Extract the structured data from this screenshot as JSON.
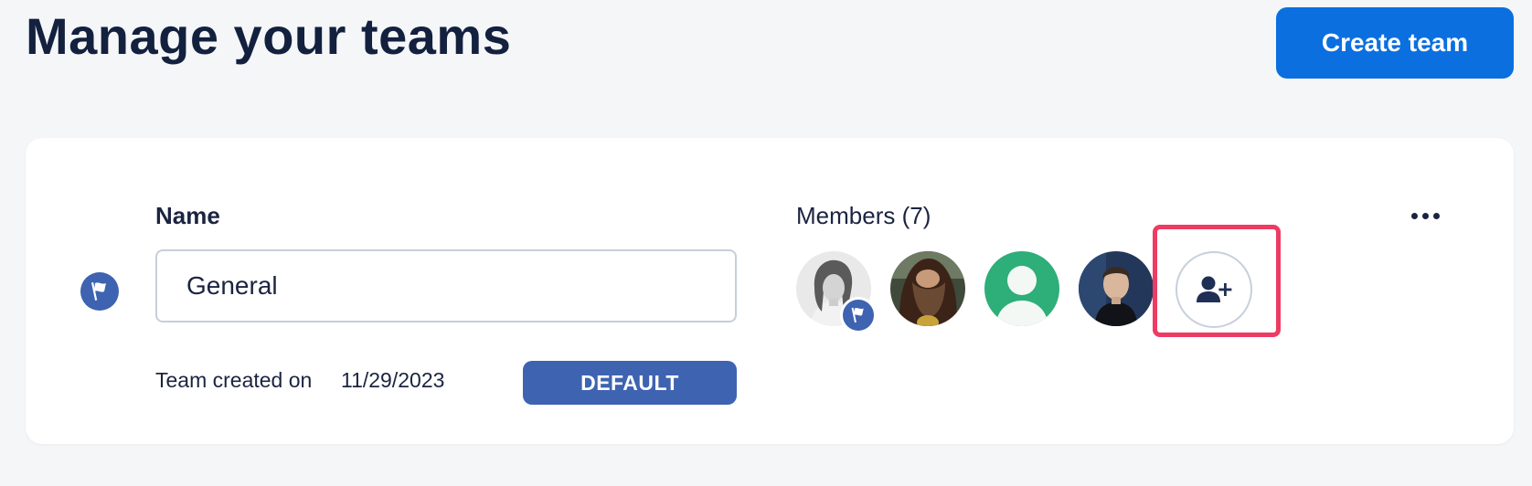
{
  "header": {
    "title": "Manage your teams",
    "create_button_label": "Create team"
  },
  "team": {
    "name_label": "Name",
    "name_value": "General",
    "created_label": "Team created on ",
    "created_date": "11/29/2023",
    "default_badge": "DEFAULT",
    "members_label": "Members (7)",
    "icons": {
      "team_icon": "flag-icon",
      "owner_badge": "flag-icon",
      "add_member": "add-user-icon",
      "menu": "more-horizontal-icon"
    },
    "highlight_color": "#ee3b63"
  },
  "colors": {
    "primary": "#0b6fe0",
    "badge": "#3e63b0",
    "text": "#1b2440",
    "avatar_placeholder": "#2eae79"
  }
}
